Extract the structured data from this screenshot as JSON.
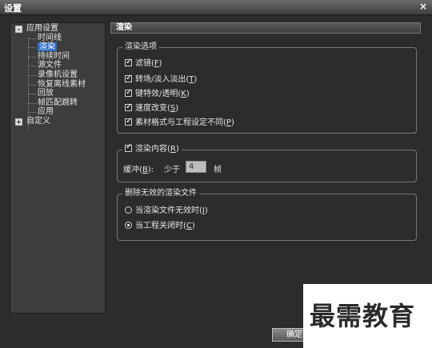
{
  "window": {
    "title": "设置",
    "close_glyph": "×"
  },
  "tree": {
    "root": "应用设置",
    "children": [
      "时间线",
      "渲染",
      "持续时间",
      "源文件",
      "录像机设置",
      "恢复离线素材",
      "回放",
      "帧匹配跳转",
      "应用"
    ],
    "selected": "渲染",
    "second_root": "自定义",
    "collapse_glyph": "-",
    "expand_glyph": "+"
  },
  "panel": {
    "title": "渲染",
    "render_options": {
      "legend": "渲染选项",
      "items": [
        {
          "label": "滤镜(",
          "key": "F",
          "suffix": ")",
          "checked": true
        },
        {
          "label": "转场/淡入淡出(",
          "key": "T",
          "suffix": ")",
          "checked": true
        },
        {
          "label": "键特效/透明(",
          "key": "K",
          "suffix": ")",
          "checked": true
        },
        {
          "label": "速度改变(",
          "key": "S",
          "suffix": ")",
          "checked": true
        },
        {
          "label": "素材格式与工程设定不同(",
          "key": "P",
          "suffix": ")",
          "checked": true
        }
      ]
    },
    "render_content": {
      "legend": "渲染内容(",
      "key": "R",
      "suffix": ")",
      "checked": true,
      "buffer_label": "缓冲(",
      "buffer_key": "B",
      "buffer_suffix": "):",
      "less_than": "少于",
      "value": "4",
      "unit": "帧"
    },
    "delete_files": {
      "legend": "删除无效的渲染文件",
      "options": [
        {
          "label": "当渲染文件无效时(",
          "key": "I",
          "suffix": ")",
          "selected": false
        },
        {
          "label": "当工程关闭时(",
          "key": "C",
          "suffix": ")",
          "selected": true
        }
      ]
    }
  },
  "buttons": {
    "ok": "确定"
  },
  "watermark": "最需教育"
}
